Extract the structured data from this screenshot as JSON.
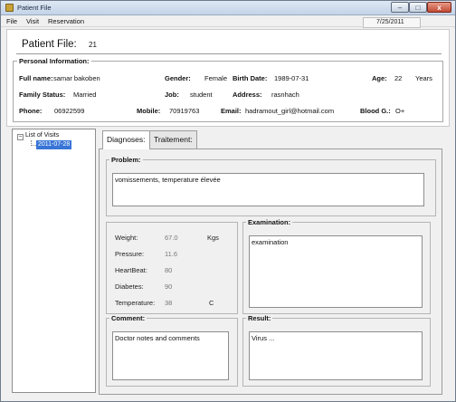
{
  "window": {
    "title": "Patient File",
    "minimize": "–",
    "maximize": "□",
    "close": "x"
  },
  "menu": {
    "items": [
      "File",
      "Visit",
      "Reservation"
    ]
  },
  "date": "7/25/2011",
  "patient": {
    "label": "Patient File:",
    "id": "21"
  },
  "personal": {
    "legend": "Personal Information:",
    "full_name_label": "Full name:",
    "full_name": "samar bakoben",
    "gender_label": "Gender:",
    "gender": "Female",
    "birth_date_label": "Birth Date:",
    "birth_date": "1989-07-31",
    "age_label": "Age:",
    "age": "22",
    "age_unit": "Years",
    "family_status_label": "Family Status:",
    "family_status": "Married",
    "job_label": "Job:",
    "job": "student",
    "address_label": "Address:",
    "address": "rasnhach",
    "phone_label": "Phone:",
    "phone": "06922599",
    "mobile_label": "Mobile:",
    "mobile": "70919763",
    "email_label": "Email:",
    "email": "hadramout_girl@hotmail.com",
    "blood_label": "Blood G.:",
    "blood": "O+"
  },
  "visits": {
    "root": "List of Visits",
    "expander": "−",
    "items": [
      "2011-07-28"
    ]
  },
  "tabs": [
    "Diagnoses:",
    "Traitement:"
  ],
  "diagnoses": {
    "problem_legend": "Problem:",
    "problem": "vomissements, temperature élevée",
    "vitals": {
      "weight_label": "Weight:",
      "weight": "67.0",
      "weight_unit": "Kgs",
      "pressure_label": "Pressure:",
      "pressure": "11.6",
      "heartbeat_label": "HeartBeat:",
      "heartbeat": "80",
      "diabetes_label": "Diabetes:",
      "diabetes": "90",
      "temperature_label": "Temperature:",
      "temperature": "38",
      "temperature_unit": "C"
    },
    "examination_legend": "Examination:",
    "examination": "examination",
    "comment_legend": "Comment:",
    "comment": "Doctor notes and comments",
    "result_legend": "Result:",
    "result": "Virus ..."
  }
}
